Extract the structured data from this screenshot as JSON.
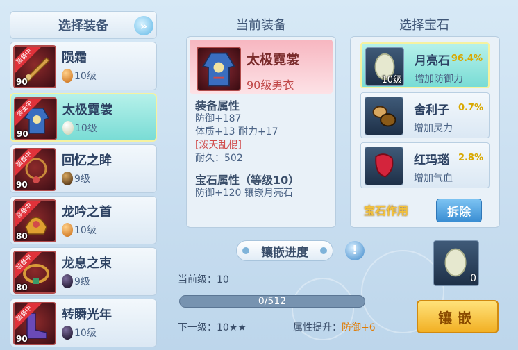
{
  "left": {
    "header": "选择装备",
    "items": [
      {
        "name": "陨霜",
        "gem_level": "10级",
        "level": "90",
        "tag": "装备中",
        "gem_color": "#e38a2a",
        "thumb_color": "#d7a048"
      },
      {
        "name": "太极霓裳",
        "gem_level": "10级",
        "level": "90",
        "tag": "装备中",
        "gem_color": "#dfe6c8",
        "thumb_color": "#3a6ec0"
      },
      {
        "name": "回忆之眸",
        "gem_level": "9级",
        "level": "90",
        "tag": "装备中",
        "gem_color": "#5a3a12",
        "thumb_color": "#c98a3a"
      },
      {
        "name": "龙吟之首",
        "gem_level": "10级",
        "level": "80",
        "tag": "装备中",
        "gem_color": "#e38a2a",
        "thumb_color": "#e0a030"
      },
      {
        "name": "龙息之束",
        "gem_level": "9级",
        "level": "80",
        "tag": "装备中",
        "gem_color": "#2a1a3a",
        "thumb_color": "#d89a38"
      },
      {
        "name": "转瞬光年",
        "gem_level": "10级",
        "level": "90",
        "tag": "装备中",
        "gem_color": "#2a1a3a",
        "thumb_color": "#6a4ab8"
      }
    ]
  },
  "middle": {
    "title": "当前装备",
    "equip_name": "太极霓裳",
    "equip_sub": "90级男衣",
    "attr_title": "装备属性",
    "attr_lines": [
      "防御+187",
      "体质+13 耐力+17"
    ],
    "special": "[泼天乱棍]",
    "durability": "耐久：502",
    "gem_attr_title": "宝石属性（等级10）",
    "gem_attr_line": "防御+120 镶嵌月亮石"
  },
  "progress": {
    "label": "镶嵌进度",
    "help": "!",
    "current_level": "当前级：10",
    "value_text": "0/512",
    "fraction": 0,
    "next_level": "下一级：10★★",
    "attr_up_label": "属性提升：",
    "attr_up_value": "防御+6"
  },
  "right": {
    "title": "选择宝石",
    "gems": [
      {
        "name": "月亮石",
        "pct": "96.4%",
        "desc": "增加防御力",
        "count": "10级"
      },
      {
        "name": "舍利子",
        "pct": "0.7%",
        "desc": "增加灵力",
        "count": ""
      },
      {
        "name": "红玛瑙",
        "pct": "2.8%",
        "desc": "增加气血",
        "count": ""
      }
    ],
    "effect_label": "宝石作用",
    "remove_label": "拆除",
    "slot_count": "0",
    "inlay_label": "镶嵌"
  }
}
